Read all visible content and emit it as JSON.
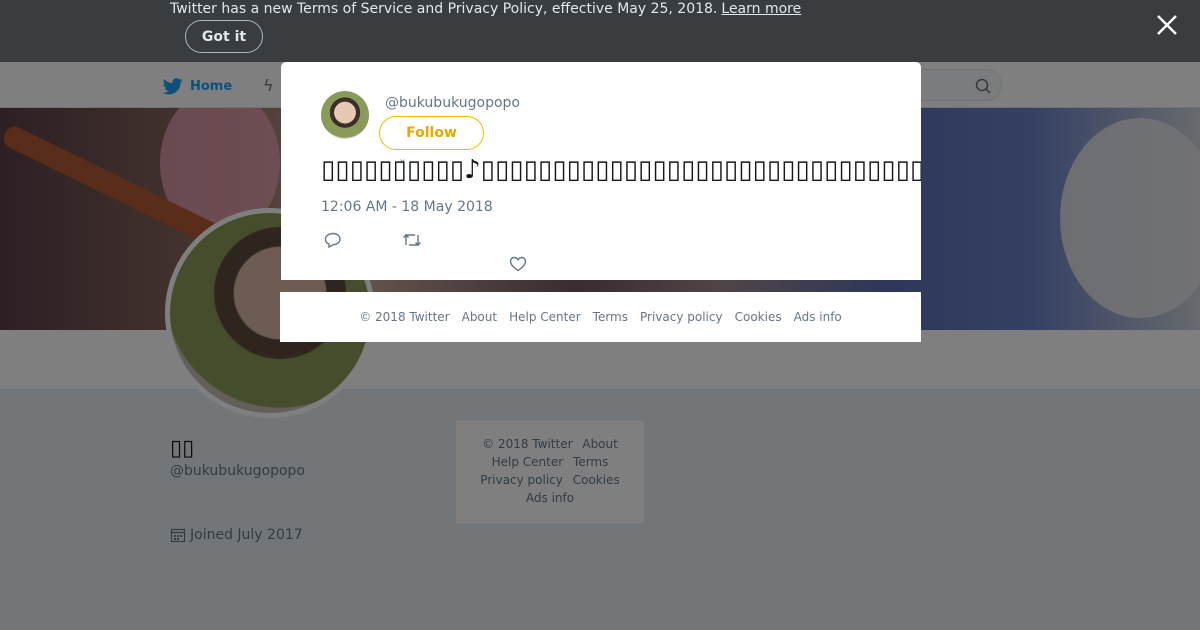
{
  "notice": {
    "text": "Twitter has a new Terms of Service and Privacy Policy, effective May 25, 2018.",
    "link": "Learn more",
    "button": "Got it"
  },
  "nav": {
    "home": "Home",
    "brand_color": "#1da1f2"
  },
  "profile": {
    "display_name": "▯▯",
    "screen_name": "@bukubukugopopo",
    "joined": "Joined July 2017"
  },
  "side_footer": {
    "items": [
      "© 2018 Twitter",
      "About",
      "Help Center",
      "Terms",
      "Privacy policy",
      "Cookies",
      "Ads info"
    ]
  },
  "modal": {
    "handle": "@bukubukugopopo",
    "follow": "Follow",
    "follow_color": "#f5b800",
    "tweet_text": "▯▯▯▯▯▯▯▯▯▯♪▯▯▯▯▯▯▯▯▯▯▯▯▯▯▯▯▯▯▯▯▯▯▯▯▯▯▯▯▯▯▯▯▯▯▯▯▯▯▯▯▯▯▯▯▯▯",
    "timestamp": "12:06 AM - 18 May 2018",
    "icons": [
      "reply-icon",
      "retweet-icon",
      "like-icon"
    ]
  },
  "modal_footer": {
    "items": [
      "© 2018 Twitter",
      "About",
      "Help Center",
      "Terms",
      "Privacy policy",
      "Cookies",
      "Ads info"
    ]
  }
}
